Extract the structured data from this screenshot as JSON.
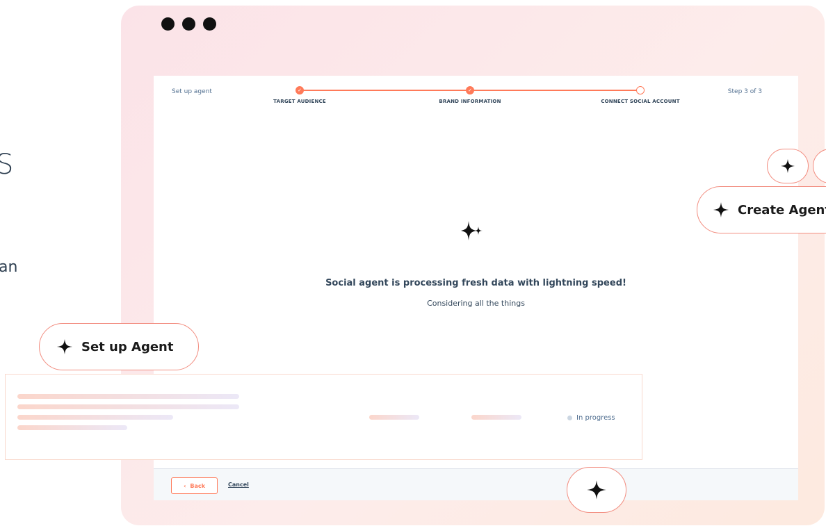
{
  "background": {
    "fragment_a": "S",
    "fragment_b": "an"
  },
  "wizard": {
    "title": "Set up agent",
    "step_count": "Step 3 of 3",
    "steps": [
      {
        "label": "TARGET AUDIENCE",
        "state": "complete"
      },
      {
        "label": "BRAND INFORMATION",
        "state": "complete"
      },
      {
        "label": "CONNECT SOCIAL ACCOUNT",
        "state": "current"
      }
    ]
  },
  "processing": {
    "title": "Social agent is processing fresh data with lightning speed!",
    "subtitle": "Considering all the things"
  },
  "footer": {
    "back_label": "Back",
    "cancel_label": "Cancel"
  },
  "list_row": {
    "status": "In progress"
  },
  "pills": {
    "setup_agent": "Set up Agent",
    "create_agent": "Create Agent"
  },
  "icons": {
    "sparkle": "sparkle-icon",
    "check": "check-icon",
    "chevron": "chevron-left-icon"
  },
  "colors": {
    "accent": "#ff7a59",
    "text": "#33475b",
    "window_bg": "#fbe3e8"
  }
}
